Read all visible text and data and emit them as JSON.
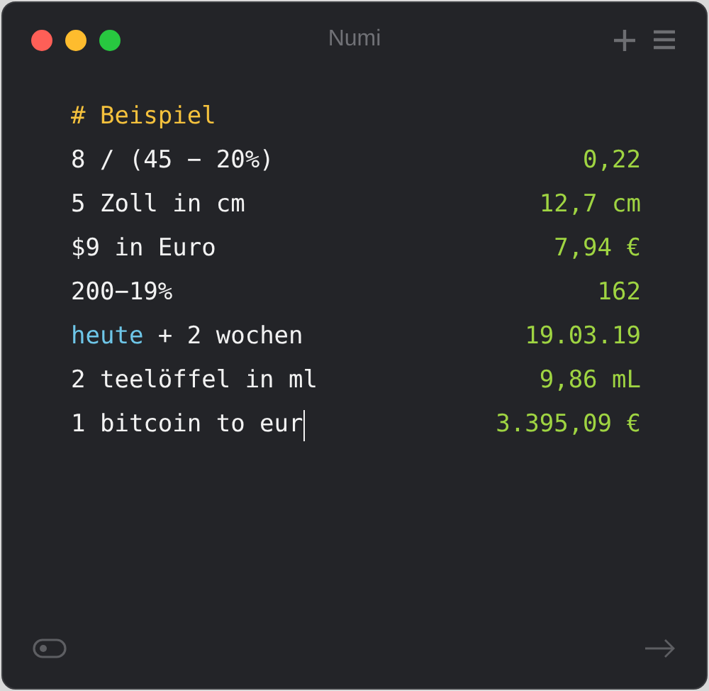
{
  "window": {
    "title": "Numi"
  },
  "lines": [
    {
      "segments": [
        {
          "text": "# Beispiel",
          "kind": "heading"
        }
      ],
      "cursor": false
    },
    {
      "segments": [
        {
          "text": "8 / (45 − 20%)",
          "kind": "plain"
        }
      ],
      "result": "0,22",
      "cursor": false
    },
    {
      "segments": [
        {
          "text": "5 Zoll in cm",
          "kind": "plain"
        }
      ],
      "result": "12,7 cm",
      "cursor": false
    },
    {
      "segments": [
        {
          "text": "$9 in Euro",
          "kind": "plain"
        }
      ],
      "result": "7,94 €",
      "cursor": false
    },
    {
      "segments": [
        {
          "text": "200−19%",
          "kind": "plain"
        }
      ],
      "result": "162",
      "cursor": false
    },
    {
      "segments": [
        {
          "text": "heute",
          "kind": "keyword"
        },
        {
          "text": " + 2 wochen",
          "kind": "plain"
        }
      ],
      "result": "19.03.19",
      "cursor": false
    },
    {
      "segments": [
        {
          "text": "2 teelöffel in ml",
          "kind": "plain"
        }
      ],
      "result": "9,86 mL",
      "cursor": false
    },
    {
      "segments": [
        {
          "text": "1 bitcoin to eur",
          "kind": "plain"
        }
      ],
      "result": "3.395,09 €",
      "cursor": true
    }
  ]
}
